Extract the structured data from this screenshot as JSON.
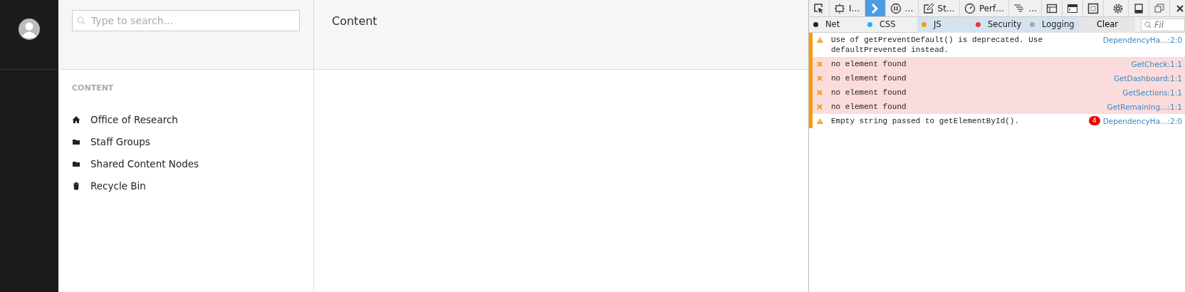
{
  "search": {
    "placeholder": "Type to search..."
  },
  "header": {
    "title": "Content"
  },
  "tree": {
    "heading": "CONTENT",
    "items": [
      {
        "label": "Office of Research",
        "kind": "home"
      },
      {
        "label": "Staff Groups",
        "kind": "folder"
      },
      {
        "label": "Shared Content Nodes",
        "kind": "folder"
      },
      {
        "label": "Recycle Bin",
        "kind": "trash"
      }
    ]
  },
  "devtools": {
    "tabs": [
      {
        "kind": "picker",
        "selected": false
      },
      {
        "label": "I…",
        "kind": "inspector",
        "selected": false
      },
      {
        "kind": "console",
        "selected": true
      },
      {
        "label": "…",
        "kind": "debugger",
        "selected": false
      },
      {
        "label": "St…",
        "kind": "style",
        "selected": false
      },
      {
        "label": "Perf…",
        "kind": "perf",
        "selected": false
      },
      {
        "label": "…",
        "kind": "network",
        "selected": false
      },
      {
        "kind": "grid",
        "selected": false
      },
      {
        "kind": "terminal",
        "selected": false
      },
      {
        "kind": "screenshot",
        "selected": false
      },
      {
        "kind": "gear",
        "selected": false
      },
      {
        "kind": "dock",
        "selected": false
      },
      {
        "kind": "window",
        "selected": false
      },
      {
        "kind": "close",
        "selected": false
      }
    ],
    "filters": [
      {
        "label": "Net",
        "color": "#222222",
        "selected": false
      },
      {
        "label": "CSS",
        "color": "#1fb5e8",
        "selected": false
      },
      {
        "label": "JS",
        "color": "#f39c12",
        "selected": true
      },
      {
        "label": "Security",
        "color": "#e03a3a",
        "selected": true
      },
      {
        "label": "Logging",
        "color": "#a8a8a8",
        "selected": true
      }
    ],
    "clear": "Clear",
    "filter_placeholder": "Fil",
    "messages": [
      {
        "kind": "warning",
        "text": "Use of getPreventDefault() is deprecated.  Use defaultPrevented instead.",
        "source": "DependencyHa…:2:0"
      },
      {
        "kind": "error",
        "text": "no element found",
        "source": "GetCheck:1:1"
      },
      {
        "kind": "error",
        "text": "no element found",
        "source": "GetDashboard:1:1"
      },
      {
        "kind": "error",
        "text": "no element found",
        "source": "GetSections:1:1"
      },
      {
        "kind": "error",
        "text": "no element found",
        "source": "GetRemaining…:1:1"
      },
      {
        "kind": "warning",
        "text": "Empty string passed to getElementById().",
        "source": "DependencyHa…:2:0",
        "count": "4"
      }
    ]
  }
}
